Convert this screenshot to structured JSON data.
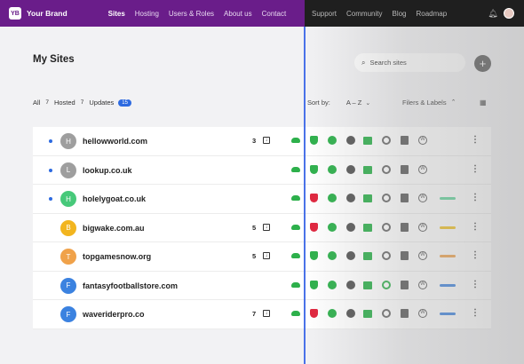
{
  "brand": {
    "logo": "YB",
    "name": "Your Brand"
  },
  "nav": [
    "Sites",
    "Hosting",
    "Users & Roles",
    "About us",
    "Contact"
  ],
  "nav_secondary": [
    "Support",
    "Community",
    "Blog",
    "Roadmap"
  ],
  "page_title": "My Sites",
  "search": {
    "placeholder": "Search sites"
  },
  "filters": {
    "all": "All",
    "all_count": "7",
    "hosted": "Hosted",
    "hosted_count": "7",
    "updates": "Updates",
    "updates_count": "15"
  },
  "sort": {
    "label": "Sort by:",
    "value": "A – Z"
  },
  "labels_toggle": "Filers & Labels",
  "colors": {
    "accent": "#2d6ae0",
    "brand_bar": "#6a1d8a",
    "ok": "#2db04b",
    "alert": "#e0243d"
  },
  "sites": [
    {
      "initial": "H",
      "domain": "hellowworld.com",
      "avatar_color": "#9e9e9e",
      "dot": true,
      "updates": "3",
      "shield": "green",
      "sync": "gray",
      "label_color": null
    },
    {
      "initial": "L",
      "domain": "lookup.co.uk",
      "avatar_color": "#9e9e9e",
      "dot": true,
      "updates": "",
      "shield": "green",
      "sync": "gray",
      "label_color": null
    },
    {
      "initial": "H",
      "domain": "holelygoat.co.uk",
      "avatar_color": "#47c97a",
      "dot": true,
      "updates": "",
      "shield": "red",
      "sync": "gray",
      "label_color": "#5fd59a"
    },
    {
      "initial": "B",
      "domain": "bigwake.com.au",
      "avatar_color": "#f2b51f",
      "dot": false,
      "updates": "5",
      "shield": "red",
      "sync": "gray",
      "label_color": "#f2c21f"
    },
    {
      "initial": "T",
      "domain": "topgamesnow.org",
      "avatar_color": "#f0a24a",
      "dot": false,
      "updates": "5",
      "shield": "green",
      "sync": "gray",
      "label_color": "#f0a24a"
    },
    {
      "initial": "F",
      "domain": "fantasyfootballstore.com",
      "avatar_color": "#3b82e0",
      "dot": false,
      "updates": "",
      "shield": "green",
      "sync": "green",
      "label_color": "#3b82e0"
    },
    {
      "initial": "F",
      "domain": "waveriderpro.co",
      "avatar_color": "#3b82e0",
      "dot": false,
      "updates": "7",
      "shield": "red",
      "sync": "gray",
      "label_color": "#3b82e0"
    }
  ]
}
